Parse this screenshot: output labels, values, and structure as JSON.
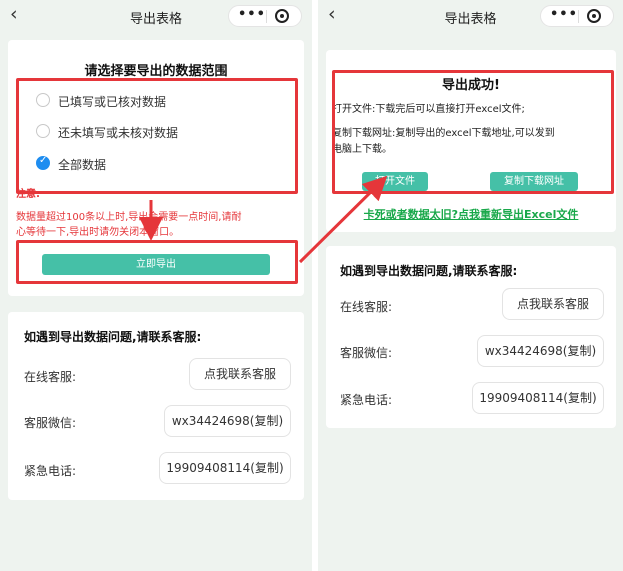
{
  "left": {
    "nav_title": "导出表格",
    "heading": "请选择要导出的数据范围",
    "options": [
      {
        "label": "已填写或已核对数据",
        "checked": false
      },
      {
        "label": "还未填写或未核对数据",
        "checked": false
      },
      {
        "label": "全部数据",
        "checked": true
      }
    ],
    "note_title": "注意:",
    "note_body_1": "数据量超过100条以上时,导出会需要一点时间,请耐",
    "note_body_2": "心等待一下,导出时请勿关闭本窗口。",
    "export_button": "立即导出"
  },
  "right": {
    "nav_title": "导出表格",
    "success_title": "导出成功!",
    "line_open": "打开文件:下载完后可以直接打开excel文件;",
    "line_copy_1": "复制下载网址:复制导出的excel下载地址,可以发到",
    "line_copy_2": "电脑上下载。",
    "open_button": "打开文件",
    "copy_button": "复制下载网址",
    "reexport_link": "卡死或者数据太旧?点我重新导出Excel文件"
  },
  "contact": {
    "title": "如遇到导出数据问题,请联系客服:",
    "online_label": "在线客服:",
    "online_value": "点我联系客服",
    "wechat_label": "客服微信:",
    "wechat_value": "wx34424698(复制)",
    "phone_label": "紧急电话:",
    "phone_value": "19909408114(复制)"
  },
  "colors": {
    "annotation": "#e5363a",
    "primary": "#45c0a7",
    "link": "#19a84a",
    "radio_checked": "#1e8df0"
  },
  "icons": {
    "back": "chevron-left-icon",
    "more": "more-dots-icon",
    "close": "target-circle-icon"
  }
}
